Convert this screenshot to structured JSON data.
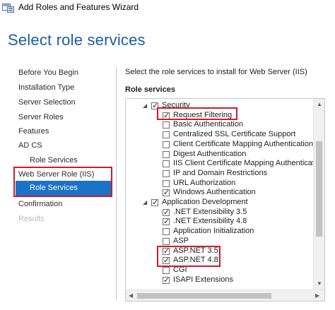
{
  "window": {
    "title": "Add Roles and Features Wizard"
  },
  "page": {
    "title": "Select role services"
  },
  "nav": {
    "items": [
      {
        "label": "Before You Begin"
      },
      {
        "label": "Installation Type"
      },
      {
        "label": "Server Selection"
      },
      {
        "label": "Server Roles"
      },
      {
        "label": "Features"
      },
      {
        "label": "AD CS"
      },
      {
        "label": "Role Services"
      },
      {
        "label": "Web Server Role (IIS)"
      },
      {
        "label": "Role Services"
      },
      {
        "label": "Confirmation"
      },
      {
        "label": "Results"
      }
    ]
  },
  "content": {
    "intro": "Select the role services to install for Web Server (IIS)",
    "section_label": "Role services",
    "tree": [
      {
        "label": "Security",
        "checked": true,
        "expander": "◢",
        "level": 0
      },
      {
        "label": "Request Filtering",
        "checked": true,
        "level": 1
      },
      {
        "label": "Basic Authentication",
        "checked": false,
        "level": 1
      },
      {
        "label": "Centralized SSL Certificate Support",
        "checked": false,
        "level": 1
      },
      {
        "label": "Client Certificate Mapping Authentication",
        "checked": false,
        "level": 1
      },
      {
        "label": "Digest Authentication",
        "checked": false,
        "level": 1
      },
      {
        "label": "IIS Client Certificate Mapping Authenticati",
        "checked": false,
        "level": 1
      },
      {
        "label": "IP and Domain Restrictions",
        "checked": false,
        "level": 1
      },
      {
        "label": "URL Authorization",
        "checked": false,
        "level": 1
      },
      {
        "label": "Windows Authentication",
        "checked": true,
        "level": 1
      },
      {
        "label": "Application Development",
        "checked": true,
        "expander": "◢",
        "level": 0
      },
      {
        "label": ".NET Extensibility 3.5",
        "checked": true,
        "level": 1
      },
      {
        "label": ".NET Extensibility 4.8",
        "checked": true,
        "level": 1
      },
      {
        "label": "Application Initialization",
        "checked": false,
        "level": 1
      },
      {
        "label": "ASP",
        "checked": false,
        "level": 1
      },
      {
        "label": "ASP.NET 3.5",
        "checked": true,
        "level": 1
      },
      {
        "label": "ASP.NET 4.8",
        "checked": true,
        "level": 1
      },
      {
        "label": "CGI",
        "checked": false,
        "level": 1
      },
      {
        "label": "ISAPI Extensions",
        "checked": true,
        "level": 1
      }
    ]
  },
  "icons": {
    "app": "server-manager-icon",
    "expand": "expanded-triangle-icon",
    "scroll_up": "scroll-up-arrow-icon",
    "scroll_down": "scroll-down-arrow-icon",
    "scroll_left": "scroll-left-arrow-icon",
    "scroll_right": "scroll-right-arrow-icon"
  },
  "colors": {
    "accent": "#1a73c6",
    "title_blue": "#1a5f9b",
    "highlight_red": "#d11a2a"
  }
}
